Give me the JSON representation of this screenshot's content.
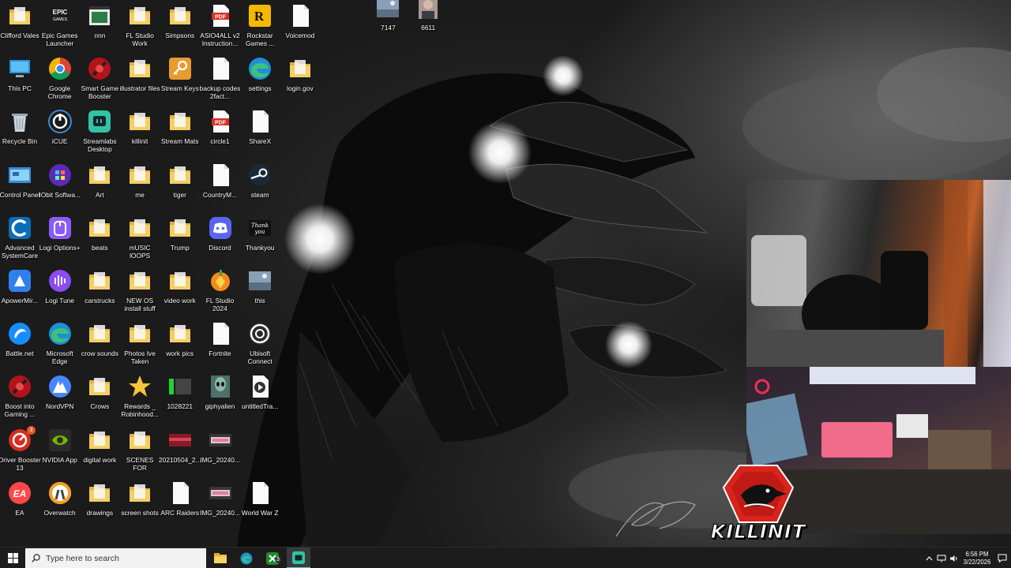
{
  "desktop_icons": [
    {
      "label": "Clifford Vales",
      "icon": "folder-icon",
      "col": 0,
      "row": 0
    },
    {
      "label": "Epic Games Launcher",
      "icon": "epic-games-icon",
      "col": 1,
      "row": 0
    },
    {
      "label": "nnn",
      "icon": "app-window-icon",
      "col": 2,
      "row": 0
    },
    {
      "label": "FL Studio Work",
      "icon": "folder-icon",
      "col": 3,
      "row": 0
    },
    {
      "label": "Simpsons",
      "icon": "folder-icon",
      "col": 4,
      "row": 0
    },
    {
      "label": "ASIO4ALL v2 Instruction...",
      "icon": "pdf-icon",
      "col": 5,
      "row": 0
    },
    {
      "label": "Rockstar Games ...",
      "icon": "rockstar-icon",
      "col": 6,
      "row": 0
    },
    {
      "label": "Voicemod",
      "icon": "file-icon",
      "col": 7,
      "row": 0
    },
    {
      "label": "7147",
      "icon": "image-thumb-icon",
      "col": 9.2,
      "row": -0.15
    },
    {
      "label": "6611",
      "icon": "photo-thumb-icon",
      "col": 10.2,
      "row": -0.15
    },
    {
      "label": "This PC",
      "icon": "this-pc-icon",
      "col": 0,
      "row": 1
    },
    {
      "label": "Google Chrome",
      "icon": "chrome-icon",
      "col": 1,
      "row": 1
    },
    {
      "label": "Smart Game Booster",
      "icon": "game-booster-icon",
      "col": 2,
      "row": 1
    },
    {
      "label": "illustrator files",
      "icon": "folder-icon",
      "col": 3,
      "row": 1
    },
    {
      "label": "Stream Keys",
      "icon": "key-icon",
      "col": 4,
      "row": 1
    },
    {
      "label": "backup codes 2fact...",
      "icon": "file-icon",
      "col": 5,
      "row": 1
    },
    {
      "label": "settings",
      "icon": "edge-icon",
      "col": 6,
      "row": 1
    },
    {
      "label": "login.gov",
      "icon": "folder-icon",
      "col": 7,
      "row": 1
    },
    {
      "label": "Recycle Bin",
      "icon": "recycle-bin-icon",
      "col": 0,
      "row": 2
    },
    {
      "label": "iCUE",
      "icon": "icue-icon",
      "col": 1,
      "row": 2
    },
    {
      "label": "Streamlabs Desktop",
      "icon": "streamlabs-icon",
      "col": 2,
      "row": 2
    },
    {
      "label": "killinit",
      "icon": "folder-icon",
      "col": 3,
      "row": 2
    },
    {
      "label": "Stream Mats",
      "icon": "folder-icon",
      "col": 4,
      "row": 2
    },
    {
      "label": "circle1",
      "icon": "pdf-icon",
      "col": 5,
      "row": 2
    },
    {
      "label": "ShareX",
      "icon": "file-icon",
      "col": 6,
      "row": 2
    },
    {
      "label": "Control Panel",
      "icon": "control-panel-icon",
      "col": 0,
      "row": 3
    },
    {
      "label": "IObit Softwa...",
      "icon": "iobit-icon",
      "col": 1,
      "row": 3
    },
    {
      "label": "Art",
      "icon": "folder-icon",
      "col": 2,
      "row": 3
    },
    {
      "label": "me",
      "icon": "folder-icon",
      "col": 3,
      "row": 3
    },
    {
      "label": "tiger",
      "icon": "folder-icon",
      "col": 4,
      "row": 3
    },
    {
      "label": "CountryM...",
      "icon": "file-icon",
      "col": 5,
      "row": 3
    },
    {
      "label": "steam",
      "icon": "steam-icon",
      "col": 6,
      "row": 3
    },
    {
      "label": "Advanced SystemCare",
      "icon": "systemcare-icon",
      "col": 0,
      "row": 4
    },
    {
      "label": "Logi Options+",
      "icon": "logi-options-icon",
      "col": 1,
      "row": 4
    },
    {
      "label": "beats",
      "icon": "folder-icon",
      "col": 2,
      "row": 4
    },
    {
      "label": "mUSIC lOOPS",
      "icon": "folder-icon",
      "col": 3,
      "row": 4
    },
    {
      "label": "Trump",
      "icon": "folder-icon",
      "col": 4,
      "row": 4
    },
    {
      "label": "Discord",
      "icon": "discord-icon",
      "col": 5,
      "row": 4
    },
    {
      "label": "Thankyou",
      "icon": "thankyou-image-icon",
      "col": 6,
      "row": 4
    },
    {
      "label": "ApowerMir...",
      "icon": "apowermirror-icon",
      "col": 0,
      "row": 5
    },
    {
      "label": "Logi Tune",
      "icon": "logi-tune-icon",
      "col": 1,
      "row": 5
    },
    {
      "label": "carstrucks",
      "icon": "folder-icon",
      "col": 2,
      "row": 5
    },
    {
      "label": "NEW OS install stuff",
      "icon": "folder-icon",
      "col": 3,
      "row": 5
    },
    {
      "label": "video work",
      "icon": "folder-icon",
      "col": 4,
      "row": 5
    },
    {
      "label": "FL Studio 2024",
      "icon": "fl-studio-icon",
      "col": 5,
      "row": 5
    },
    {
      "label": "this",
      "icon": "image-thumb-icon",
      "col": 6,
      "row": 5
    },
    {
      "label": "Battle.net",
      "icon": "battlenet-icon",
      "col": 0,
      "row": 6
    },
    {
      "label": "Microsoft Edge",
      "icon": "edge-icon",
      "col": 1,
      "row": 6
    },
    {
      "label": "crow sounds",
      "icon": "folder-icon",
      "col": 2,
      "row": 6
    },
    {
      "label": "Photos Ive Taken",
      "icon": "folder-icon",
      "col": 3,
      "row": 6
    },
    {
      "label": "work pics",
      "icon": "folder-icon",
      "col": 4,
      "row": 6
    },
    {
      "label": "Fortnite",
      "icon": "file-icon",
      "col": 5,
      "row": 6
    },
    {
      "label": "Ubisoft Connect",
      "icon": "ubisoft-icon",
      "col": 6,
      "row": 6
    },
    {
      "label": "Boost into Gaming ...",
      "icon": "game-booster-icon",
      "col": 0,
      "row": 7
    },
    {
      "label": "NordVPN",
      "icon": "nordvpn-icon",
      "col": 1,
      "row": 7
    },
    {
      "label": "Crows",
      "icon": "folder-icon",
      "col": 2,
      "row": 7
    },
    {
      "label": "Rewards _ Robinhood...",
      "icon": "star-icon",
      "col": 3,
      "row": 7
    },
    {
      "label": "1028221",
      "icon": "green-bar-image-icon",
      "col": 4,
      "row": 7
    },
    {
      "label": "giphyalien",
      "icon": "alien-image-icon",
      "col": 5,
      "row": 7
    },
    {
      "label": "untitledTra...",
      "icon": "audio-file-icon",
      "col": 6,
      "row": 7
    },
    {
      "label": "Driver Booster 13",
      "icon": "driver-booster-icon",
      "col": 0,
      "row": 8
    },
    {
      "label": "NVIDIA App",
      "icon": "nvidia-icon",
      "col": 1,
      "row": 8
    },
    {
      "label": "digital work",
      "icon": "folder-icon",
      "col": 2,
      "row": 8
    },
    {
      "label": "SCENES FOR STREAM",
      "icon": "folder-icon",
      "col": 3,
      "row": 8
    },
    {
      "label": "20210504_2...",
      "icon": "red-photo-icon",
      "col": 4,
      "row": 8
    },
    {
      "label": "IMG_20240...",
      "icon": "keyboard-photo-icon",
      "col": 5,
      "row": 8
    },
    {
      "label": "EA",
      "icon": "ea-icon",
      "col": 0,
      "row": 9
    },
    {
      "label": "Overwatch",
      "icon": "overwatch-icon",
      "col": 1,
      "row": 9
    },
    {
      "label": "drawings",
      "icon": "folder-icon",
      "col": 2,
      "row": 9
    },
    {
      "label": "screen shots",
      "icon": "folder-icon",
      "col": 3,
      "row": 9
    },
    {
      "label": "ARC Raiders",
      "icon": "file-icon",
      "col": 4,
      "row": 9
    },
    {
      "label": "IMG_20240...",
      "icon": "keyboard-photo-icon",
      "col": 5,
      "row": 9
    },
    {
      "label": "World War Z",
      "icon": "file-icon",
      "col": 6,
      "row": 9
    }
  ],
  "overlay": {
    "brand_text": "KILLINIT"
  },
  "taskbar": {
    "search_placeholder": "Type here to search",
    "pinned": [
      {
        "icon": "file-explorer-icon"
      },
      {
        "icon": "edge-icon"
      },
      {
        "icon": "xbox-icon",
        "badge": "3"
      },
      {
        "icon": "streamlabs-icon"
      }
    ],
    "clock_time": "6:56 PM",
    "clock_date": "3/22/2026"
  },
  "badges": {
    "driver_booster": "3"
  },
  "colors": {
    "folder": "#e8c15a",
    "taskbar": "#1c1c1c",
    "brand_red": "#d8241c"
  }
}
